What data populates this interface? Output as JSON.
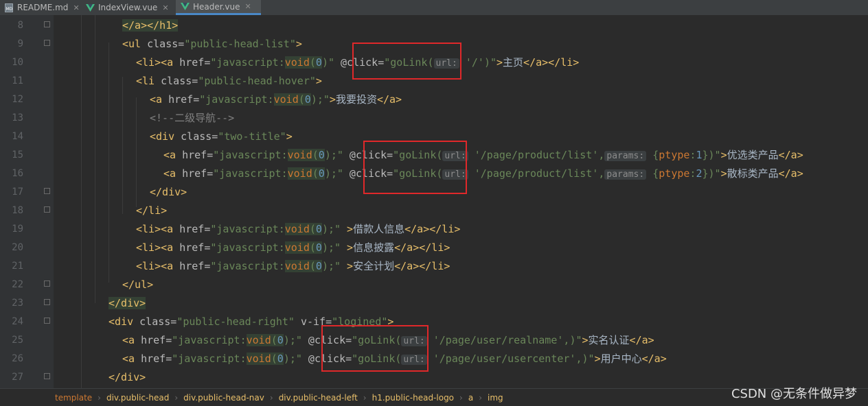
{
  "tabs": [
    {
      "label": "README.md",
      "icon": "markdown-file-icon",
      "active": false
    },
    {
      "label": "IndexView.vue",
      "icon": "vue-file-icon",
      "active": false
    },
    {
      "label": "Header.vue",
      "icon": "vue-file-icon",
      "active": true
    }
  ],
  "line_numbers": [
    "8",
    "9",
    "10",
    "11",
    "12",
    "13",
    "14",
    "15",
    "16",
    "17",
    "18",
    "19",
    "20",
    "21",
    "22",
    "23",
    "24",
    "25",
    "26",
    "27"
  ],
  "code": {
    "l8": {
      "t1": "</a></h1>"
    },
    "l9": {
      "t1": "<ul ",
      "a1": "class=",
      "s1": "\"public-head-list\"",
      "t2": ">"
    },
    "l10": {
      "t1": "<li><a ",
      "a1": "href=",
      "s1": "\"javascript:",
      "k1": "void",
      "s2": "(",
      "n1": "0",
      "s3": ")\"",
      "a2": " @click=",
      "s4": "\"goLink(",
      "h1": "url:",
      "s5": " '/'",
      "s6": ")\"",
      "t2": ">",
      "x1": "主页",
      "t3": "</a></li>"
    },
    "l11": {
      "t1": "<li ",
      "a1": "class=",
      "s1": "\"public-head-hover\"",
      "t2": ">"
    },
    "l12": {
      "t1": "<a ",
      "a1": "href=",
      "s1": "\"javascript:",
      "k1": "void",
      "s2": "(",
      "n1": "0",
      "s3": ");\"",
      "t2": ">",
      "x1": "我要投资",
      "t3": "</a>"
    },
    "l13": {
      "c1": "<!--二级导航-->"
    },
    "l14": {
      "t1": "<div ",
      "a1": "class=",
      "s1": "\"two-title\"",
      "t2": ">"
    },
    "l15": {
      "t1": "<a ",
      "a1": "href=",
      "s1": "\"javascript:",
      "k1": "void",
      "s2": "(",
      "n1": "0",
      "s3": ");\"",
      "a2": " @click=",
      "s4": "\"goLink(",
      "h1": "url:",
      "s5": " '/page/product/list',",
      "h2": "params:",
      "s6": " {",
      "p1": "ptype",
      "s7": ":",
      "n2": "1",
      "s8": "})\"",
      "t2": ">",
      "x1": "优选类产品",
      "t3": "</a>"
    },
    "l16": {
      "t1": "<a ",
      "a1": "href=",
      "s1": "\"javascript:",
      "k1": "void",
      "s2": "(",
      "n1": "0",
      "s3": ");\"",
      "a2": " @click=",
      "s4": "\"goLink(",
      "h1": "url:",
      "s5": " '/page/product/list',",
      "h2": "params:",
      "s6": " {",
      "p1": "ptype",
      "s7": ":",
      "n2": "2",
      "s8": "})\"",
      "t2": ">",
      "x1": "散标类产品",
      "t3": "</a>"
    },
    "l17": {
      "t1": "</div>"
    },
    "l18": {
      "t1": "</li>"
    },
    "l19": {
      "t1": "<li><a ",
      "a1": "href=",
      "s1": "\"javascript:",
      "k1": "void",
      "s2": "(",
      "n1": "0",
      "s3": ");\"",
      "t2": " >",
      "x1": "借款人信息",
      "t3": "</a></li>"
    },
    "l20": {
      "t1": "<li><a ",
      "a1": "href=",
      "s1": "\"javascript:",
      "k1": "void",
      "s2": "(",
      "n1": "0",
      "s3": ");\"",
      "t2": " >",
      "x1": "信息披露",
      "t3": "</a></li>"
    },
    "l21": {
      "t1": "<li><a ",
      "a1": "href=",
      "s1": "\"javascript:",
      "k1": "void",
      "s2": "(",
      "n1": "0",
      "s3": ");\"",
      "t2": " >",
      "x1": "安全计划",
      "t3": "</a></li>"
    },
    "l22": {
      "t1": "</ul>"
    },
    "l23": {
      "t1": "</div>"
    },
    "l24": {
      "t1": "<div ",
      "a1": "class=",
      "s1": "\"public-head-right\"",
      "a2": " v-if=",
      "s2": "\"logined\"",
      "t2": ">"
    },
    "l25": {
      "t1": "<a ",
      "a1": "href=",
      "s1": "\"javascript:",
      "k1": "void",
      "s2": "(",
      "n1": "0",
      "s3": ");\"",
      "a2": " @click=",
      "s4": "\"goLink(",
      "h1": "url:",
      "s5": " '/page/user/realname',",
      "s6": ")\"",
      "t2": ">",
      "x1": "实名认证",
      "t3": "</a>"
    },
    "l26": {
      "t1": "<a ",
      "a1": "href=",
      "s1": "\"javascript:",
      "k1": "void",
      "s2": "(",
      "n1": "0",
      "s3": ");\"",
      "a2": " @click=",
      "s4": "\"goLink(",
      "h1": "url:",
      "s5": " '/page/user/usercenter',",
      "s6": ")\"",
      "t2": ">",
      "x1": "用户中心",
      "t3": "</a>"
    },
    "l27": {
      "t1": "</div>"
    }
  },
  "breadcrumb": [
    "template",
    "div.public-head",
    "div.public-head-nav",
    "div.public-head-left",
    "h1.public-head-logo",
    "a",
    "img"
  ],
  "watermark": "CSDN @无条件做异梦",
  "colors": {
    "background": "#2b2b2b",
    "tag": "#e8bf6a",
    "string": "#6a8759",
    "keyword": "#cc7832",
    "number": "#6897bb",
    "annotation_box": "#e0282a"
  }
}
